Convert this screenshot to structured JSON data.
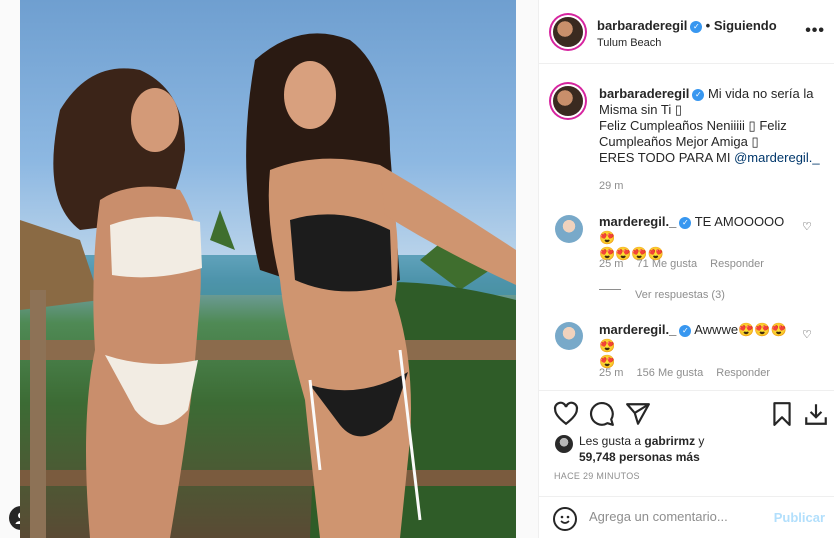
{
  "post": {
    "author": "barbaraderegil",
    "following_label": "• Siguiendo",
    "location": "Tulum Beach",
    "more_icon": "more-horizontal-icon"
  },
  "caption": {
    "author": "barbaraderegil",
    "text": "Mi vida no sería la Misma sin Ti ▯",
    "line2": "Feliz Cumpleaños Neniiiii ▯ Feliz Cumpleaños Mejor Amiga ▯",
    "line3_prefix": "ERES TODO PARA MI ",
    "mention": "@marderegil._",
    "time": "29 m"
  },
  "comments": [
    {
      "author": "marderegil._",
      "text": "TE AMOOOOO😍",
      "text2": "😍😍😍😍",
      "time": "25 m",
      "likes": "71 Me gusta",
      "reply": "Responder",
      "view_replies": "Ver respuestas (3)"
    },
    {
      "author": "marderegil._",
      "text": "Awwwe😍😍😍😍",
      "text2": "😍",
      "time": "25 m",
      "likes": "156 Me gusta",
      "reply": "Responder"
    }
  ],
  "likes": {
    "prefix": "Les gusta a ",
    "user": "gabrirmz",
    "mid": " y",
    "count": "59,748 personas más"
  },
  "time_ago": "HACE 29 MINUTOS",
  "add_comment": {
    "placeholder": "Agrega un comentario...",
    "publish": "Publicar"
  },
  "colors": {
    "verified": "#3897f0",
    "link": "#00376b",
    "publish_disabled": "#b2dffc"
  }
}
